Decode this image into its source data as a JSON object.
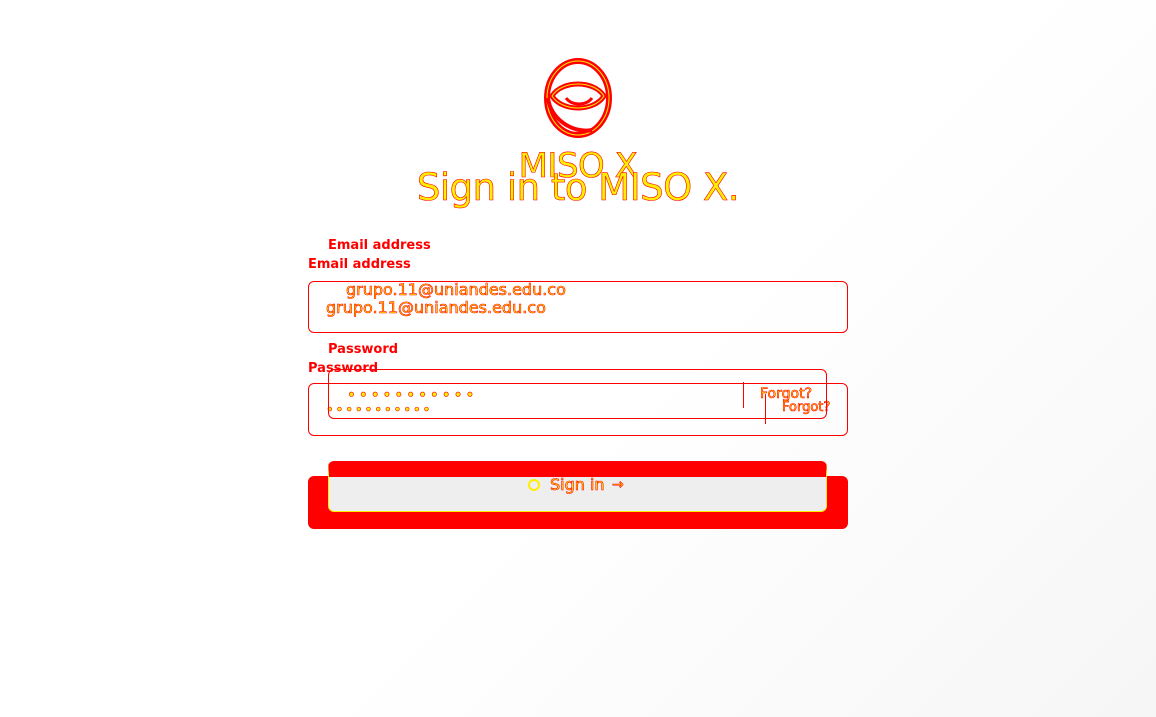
{
  "app": {
    "brand": "MISO X",
    "heading": "Sign in to MISO X."
  },
  "form": {
    "email_label": "Email address",
    "email_value": "grupo.11@uniandes.edu.co",
    "password_label": "Password",
    "password_value": "•••••••••••",
    "forgot_label": "Forgot?",
    "submit_label": "Sign in",
    "submit_arrow": "→"
  },
  "icons": {
    "logo": "miso-logo-icon",
    "spinner": "loading-spinner-icon",
    "arrow": "arrow-right-icon"
  },
  "colors": {
    "primary": "#ff0000",
    "highlight": "#ffee00",
    "button_face": "#eeeeee"
  }
}
